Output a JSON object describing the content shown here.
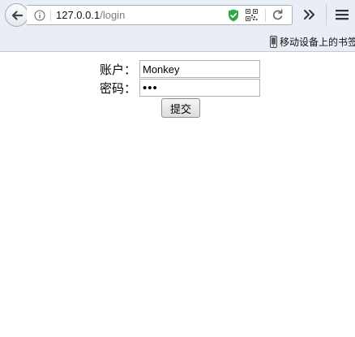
{
  "browser": {
    "url": {
      "host": "127.0.0.1",
      "path": "/login"
    },
    "bookmarks": {
      "mobile_label": "移动设备上的书签"
    },
    "icons": {
      "back": "back-arrow-icon",
      "info": "info-icon",
      "shield": "shield-check-icon",
      "qr": "qr-code-icon",
      "reload": "reload-icon",
      "overflow": "double-chevron-right-icon",
      "menu": "hamburger-menu-icon",
      "mobile": "mobile-phone-icon"
    },
    "colors": {
      "toolbar": "#e9eef6",
      "shield": "#2fa84a"
    }
  },
  "form": {
    "account_label": "账户：",
    "account_value": "Monkey",
    "password_label": "密码：",
    "password_value": "abc",
    "submit_label": "提交"
  }
}
